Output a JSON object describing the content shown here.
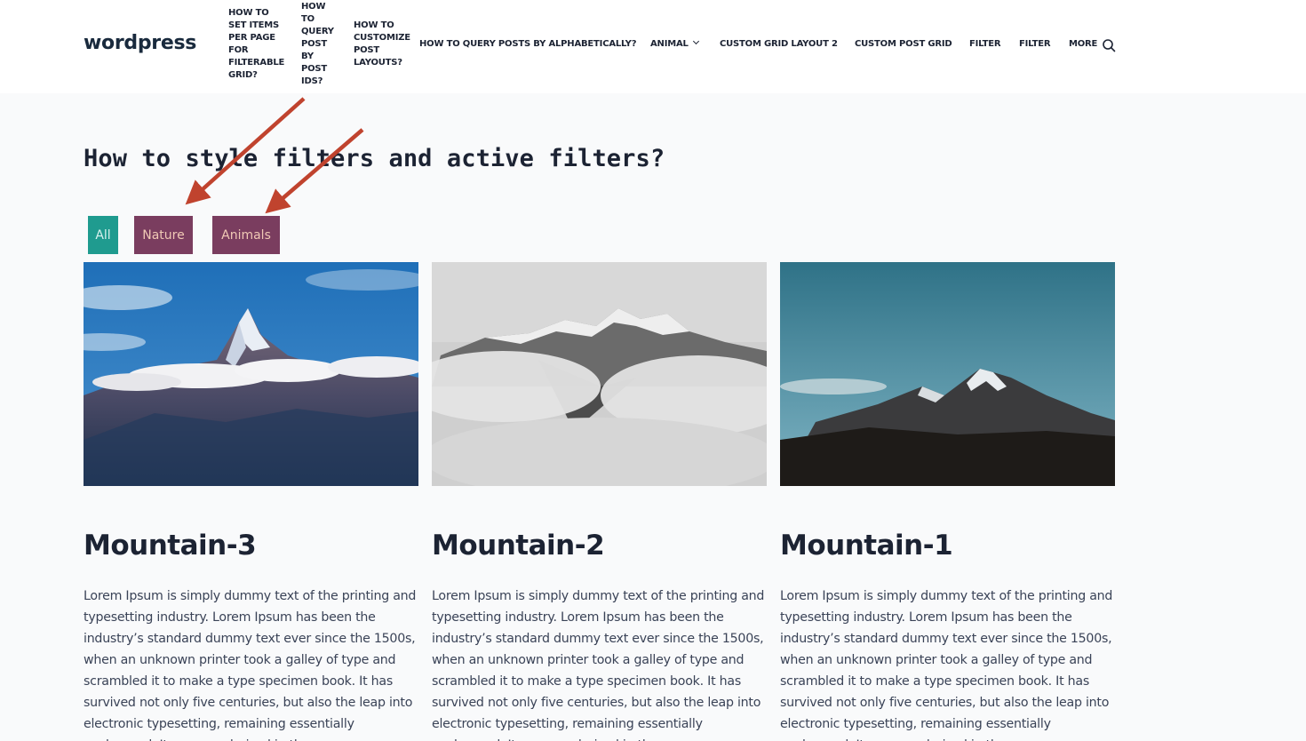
{
  "site": {
    "logo": "wordpress"
  },
  "nav": {
    "items": [
      "How to set items per page for filterable grid?",
      "How to query post by post IDs?",
      "How to customize post layouts?",
      "How to query posts by alphabetically?",
      "Animal",
      "Custom Grid Layout 2",
      "Custom Post Grid",
      "Filter",
      "Filter",
      "More"
    ],
    "multiline": {
      "item0": [
        "HOW TO",
        "SET ITEMS",
        "PER PAGE",
        "FOR",
        "FILTERABLE",
        "GRID?"
      ],
      "item1": [
        "HOW",
        "TO",
        "QUERY",
        "POST",
        "BY",
        "POST",
        "IDS?"
      ],
      "item2": [
        "HOW TO",
        "CUSTOMIZE",
        "POST",
        "LAYOUTS?"
      ]
    },
    "search_icon": "search-icon"
  },
  "page": {
    "title": "How to style filters and active filters?"
  },
  "filters": {
    "all": "All",
    "nature": "Nature",
    "animals": "Animals",
    "colors": {
      "active": "#1f9b8f",
      "inactive": "#7a3d5f",
      "text": "#f0c9b5"
    }
  },
  "annotation": {
    "arrow_color": "#c0432e"
  },
  "cards": [
    {
      "title": "Mountain-3",
      "text": "Lorem Ipsum is simply dummy text of the printing and typesetting industry. Lorem Ipsum has been the industry’s standard dummy text ever since the 1500s, when an unknown printer took a galley of type and scrambled it to make a type specimen book. It has survived not only five centuries, but also the leap into electronic typesetting, remaining essentially unchanged. It was popularised in the"
    },
    {
      "title": "Mountain-2",
      "text": "Lorem Ipsum is simply dummy text of the printing and typesetting industry. Lorem Ipsum has been the industry’s standard dummy text ever since the 1500s, when an unknown printer took a galley of type and scrambled it to make a type specimen book. It has survived not only five centuries, but also the leap into electronic typesetting, remaining essentially unchanged. It was popularised in the"
    },
    {
      "title": "Mountain-1",
      "text": "Lorem Ipsum is simply dummy text of the printing and typesetting industry. Lorem Ipsum has been the industry’s standard dummy text ever since the 1500s, when an unknown printer took a galley of type and scrambled it to make a type specimen book. It has survived not only five centuries, but also the leap into electronic typesetting, remaining essentially unchanged. It was popularised in the"
    }
  ]
}
